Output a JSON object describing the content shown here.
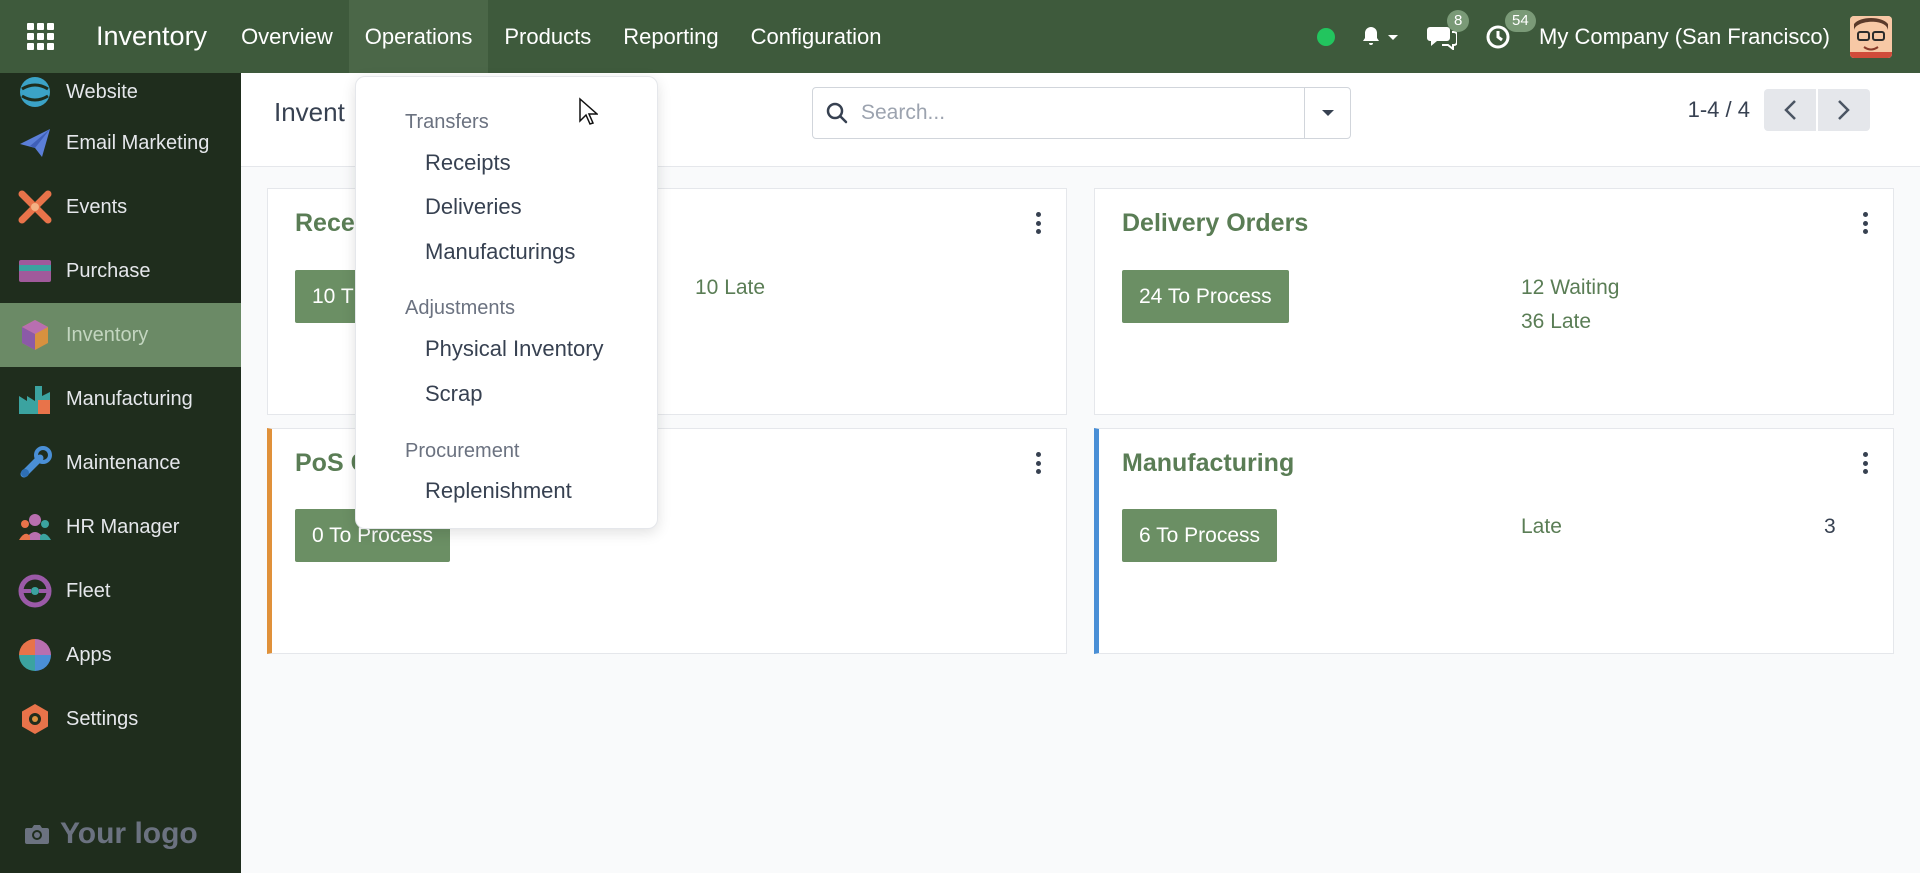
{
  "navbar": {
    "brand": "Inventory",
    "menu": [
      "Overview",
      "Operations",
      "Products",
      "Reporting",
      "Configuration"
    ],
    "active_menu": "Operations",
    "chat_count": "8",
    "activity_count": "54",
    "company": "My Company (San Francisco)",
    "status_color": "#22c55e"
  },
  "sidebar": {
    "items": [
      {
        "label": "Website",
        "icon": "website-icon"
      },
      {
        "label": "Email Marketing",
        "icon": "email-marketing-icon"
      },
      {
        "label": "Events",
        "icon": "events-icon"
      },
      {
        "label": "Purchase",
        "icon": "purchase-icon"
      },
      {
        "label": "Inventory",
        "icon": "inventory-icon"
      },
      {
        "label": "Manufacturing",
        "icon": "manufacturing-icon"
      },
      {
        "label": "Maintenance",
        "icon": "maintenance-icon"
      },
      {
        "label": "HR Manager",
        "icon": "hr-manager-icon"
      },
      {
        "label": "Fleet",
        "icon": "fleet-icon"
      },
      {
        "label": "Apps",
        "icon": "apps-icon"
      },
      {
        "label": "Settings",
        "icon": "settings-icon"
      }
    ],
    "active": "Inventory",
    "logo_text": "Your logo"
  },
  "control_panel": {
    "breadcrumb": "Invent",
    "search_placeholder": "Search...",
    "pager": "1-4 / 4"
  },
  "cards": [
    {
      "title": "Recei",
      "button": "10 T",
      "stats": [
        "10 Late"
      ],
      "accent": null
    },
    {
      "title": "Delivery Orders",
      "button": "24 To Process",
      "stats": [
        "12 Waiting",
        "36 Late"
      ],
      "accent": null
    },
    {
      "title": "PoS C",
      "button": "0 To Process",
      "stats": [],
      "accent": "#e0913a"
    },
    {
      "title": "Manufacturing",
      "button": "6 To Process",
      "stats": [
        "Late",
        "3"
      ],
      "accent": "#4a8fd6"
    }
  ],
  "dropdown": {
    "sections": [
      {
        "header": "Transfers",
        "items": [
          "Receipts",
          "Deliveries",
          "Manufacturings"
        ]
      },
      {
        "header": "Adjustments",
        "items": [
          "Physical Inventory",
          "Scrap"
        ]
      },
      {
        "header": "Procurement",
        "items": [
          "Replenishment"
        ]
      }
    ]
  },
  "colors": {
    "navbar_bg": "#3e5a3c",
    "sidebar_bg": "#1f2d1d",
    "accent_green": "#6b8f64"
  }
}
